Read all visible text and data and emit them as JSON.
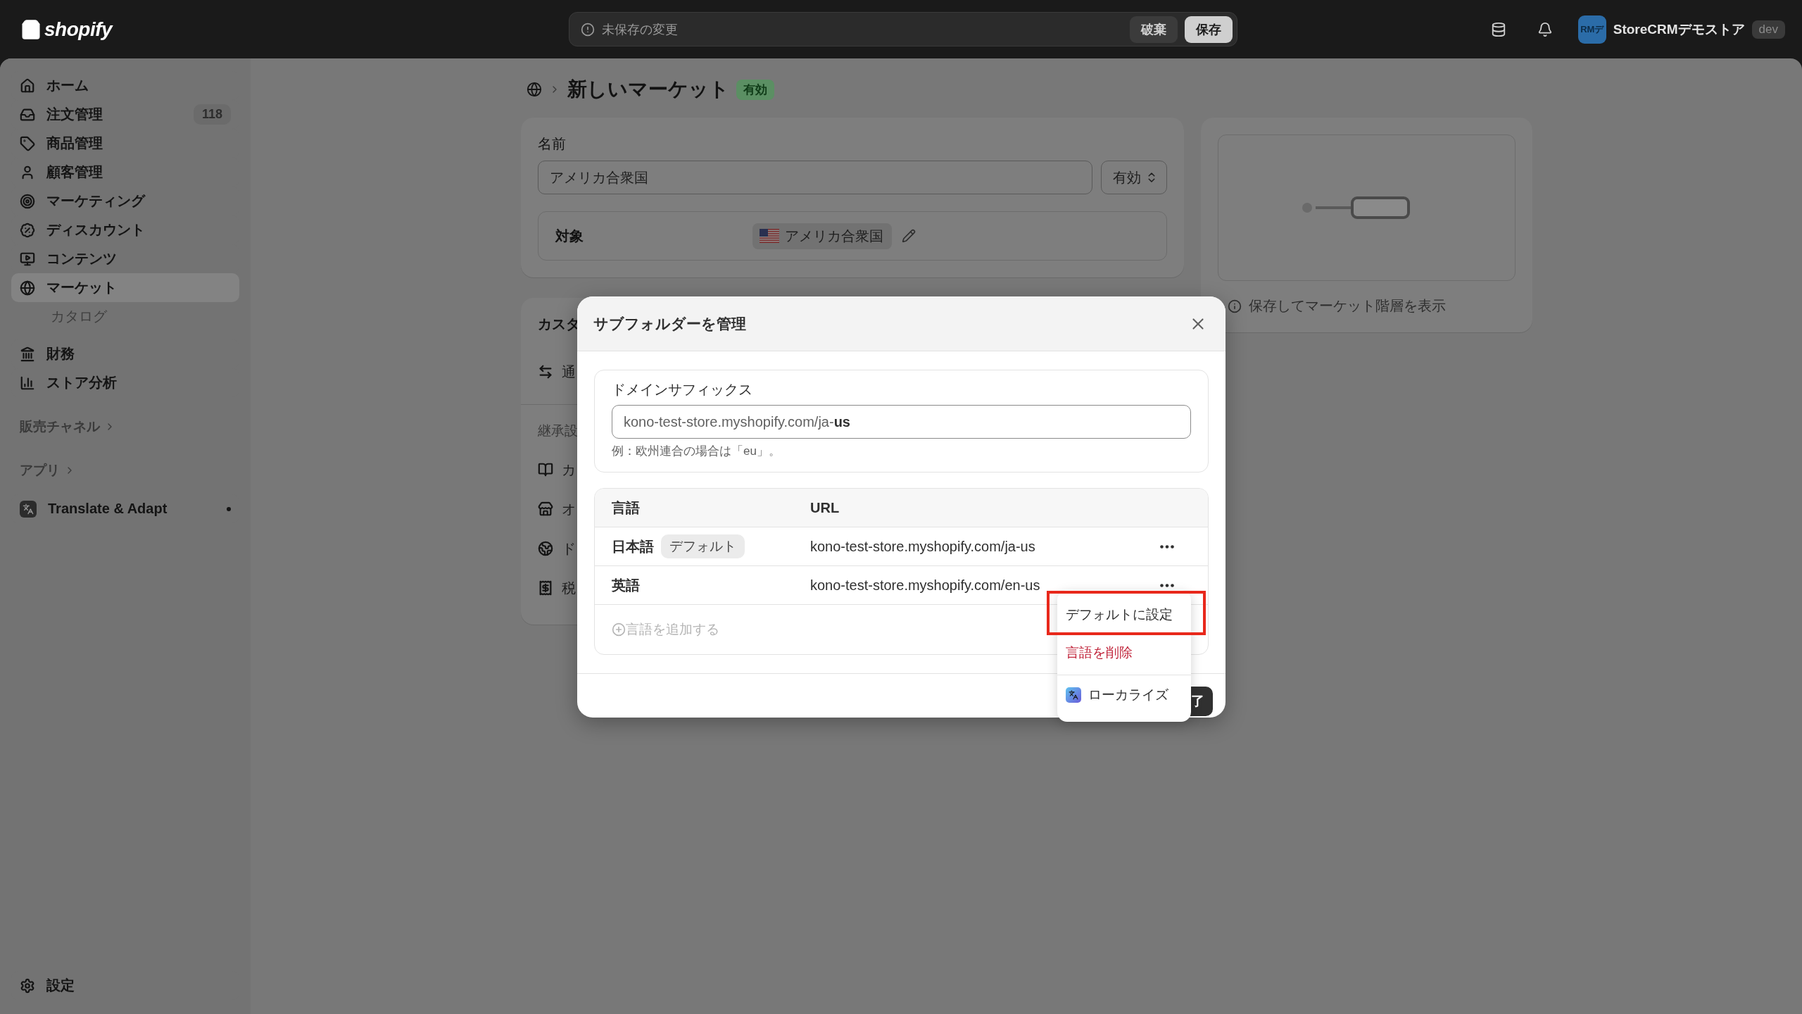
{
  "topbar": {
    "logo": "shopify",
    "unsaved_bar": {
      "message": "未保存の変更",
      "buttons": [
        {
          "label": "破棄",
          "kind": "secondary"
        },
        {
          "label": "保存",
          "kind": "primary"
        }
      ]
    },
    "store": {
      "avatar": "RMデ",
      "name": "StoreCRMデモストア",
      "badge": "dev"
    }
  },
  "sidebar": {
    "items": [
      {
        "label": "ホーム",
        "selected": false
      },
      {
        "label": "注文管理",
        "selected": false,
        "count": "118"
      },
      {
        "label": "商品管理",
        "selected": false
      },
      {
        "label": "顧客管理",
        "selected": false
      },
      {
        "label": "マーケティング",
        "selected": false
      },
      {
        "label": "ディスカウント",
        "selected": false
      },
      {
        "label": "コンテンツ",
        "selected": false
      },
      {
        "label": "マーケット",
        "selected": true,
        "children": [
          {
            "label": "カタログ",
            "selected": false
          }
        ]
      }
    ],
    "items_2": [
      {
        "label": "財務",
        "selected": false
      },
      {
        "label": "ストア分析",
        "selected": false
      }
    ],
    "sections": [
      "販売チャネル",
      "アプリ"
    ],
    "apps": [
      {
        "label": "Translate & Adapt",
        "notification": true
      }
    ],
    "settings": "設定"
  },
  "page": {
    "title": "新しいマーケット",
    "status": "有効",
    "name_card": {
      "label": "名前",
      "value": "アメリカ合衆国",
      "status_select": "有効",
      "target_label": "対象",
      "target_value": "アメリカ合衆国"
    },
    "custom_card": {
      "heading": "カスタ",
      "rows": [
        "通"
      ],
      "section_label": "継承設",
      "section_rows": [
        "カ",
        "オ",
        "ド",
        "税"
      ]
    },
    "preview_card": {
      "caption": "保存してマーケット階層を表示"
    }
  },
  "modal": {
    "title": "サブフォルダーを管理",
    "domain_suffix": {
      "label": "ドメインサフィックス",
      "prefix": "kono-test-store.myshopify.com/ja-",
      "value": "us",
      "help": "例：欧州連合の場合は「eu」。"
    },
    "table": {
      "columns": [
        "言語",
        "URL"
      ],
      "rows": [
        {
          "language": "日本語",
          "badge": "デフォルト",
          "url": "kono-test-store.myshopify.com/ja-us"
        },
        {
          "language": "英語",
          "url": "kono-test-store.myshopify.com/en-us"
        }
      ]
    },
    "add_language": "言語を追加する",
    "footer_button": "了",
    "menu": {
      "items": [
        {
          "label": "デフォルトに設定",
          "kind": "normal",
          "highlighted": true
        },
        {
          "label": "言語を削除",
          "kind": "destructive",
          "highlighted": false
        },
        {
          "label": "ローカライズ",
          "kind": "app",
          "highlighted": false
        }
      ]
    }
  }
}
